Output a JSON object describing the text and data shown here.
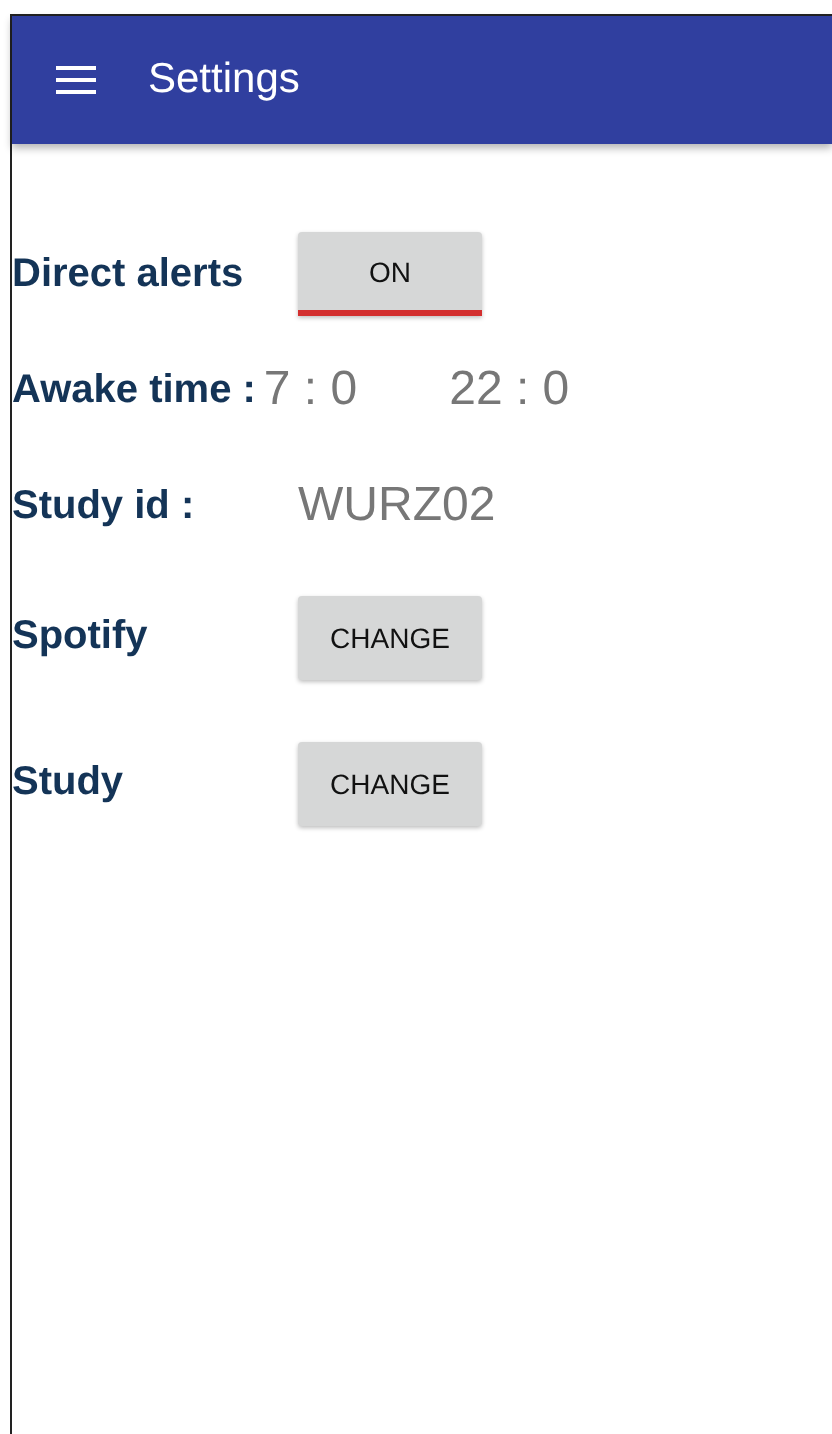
{
  "app_bar": {
    "title": "Settings"
  },
  "rows": [
    {
      "kind": "toggle",
      "label": "Direct alerts",
      "button": "ON",
      "on": true
    },
    {
      "kind": "times",
      "label": "Awake time :",
      "start": "7 : 0",
      "end": "22 : 0"
    },
    {
      "kind": "value",
      "label": "Study id :",
      "value": "WURZ02"
    },
    {
      "kind": "button",
      "label": "Spotify",
      "button": "CHANGE"
    },
    {
      "kind": "button",
      "label": "Study",
      "button": "CHANGE"
    }
  ]
}
